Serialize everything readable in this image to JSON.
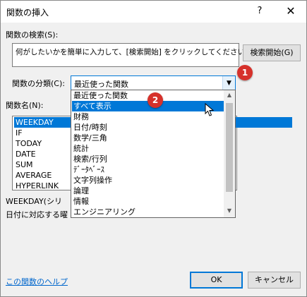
{
  "dialog": {
    "title": "関数の挿入",
    "help": "?",
    "close": "✕"
  },
  "search": {
    "label": "関数の検索(S):",
    "text": "何がしたいかを簡単に入力して、[検索開始] をクリックしてください。",
    "button": "検索開始(G)"
  },
  "category": {
    "label": "関数の分類(C):",
    "value": "最近使った関数",
    "options": [
      "最近使った関数",
      "すべて表示",
      "財務",
      "日付/時刻",
      "数学/三角",
      "統計",
      "検索/行列",
      "ﾃﾞｰﾀﾍﾞｰｽ",
      "文字列操作",
      "論理",
      "情報",
      "エンジニアリング"
    ],
    "highlighted": "すべて表示"
  },
  "functions": {
    "label": "関数名(N):",
    "items": [
      "WEEKDAY",
      "IF",
      "TODAY",
      "DATE",
      "SUM",
      "AVERAGE",
      "HYPERLINK"
    ],
    "selected": "WEEKDAY"
  },
  "description": {
    "signature": "WEEKDAY(シリ",
    "text": "日付に対応する曜"
  },
  "footer": {
    "help_link": "この関数のヘルプ",
    "ok": "OK",
    "cancel": "キャンセル"
  },
  "callouts": [
    "1",
    "2"
  ],
  "colors": {
    "accent": "#0078d7",
    "callout": "#d6312b",
    "link": "#0066cc"
  }
}
